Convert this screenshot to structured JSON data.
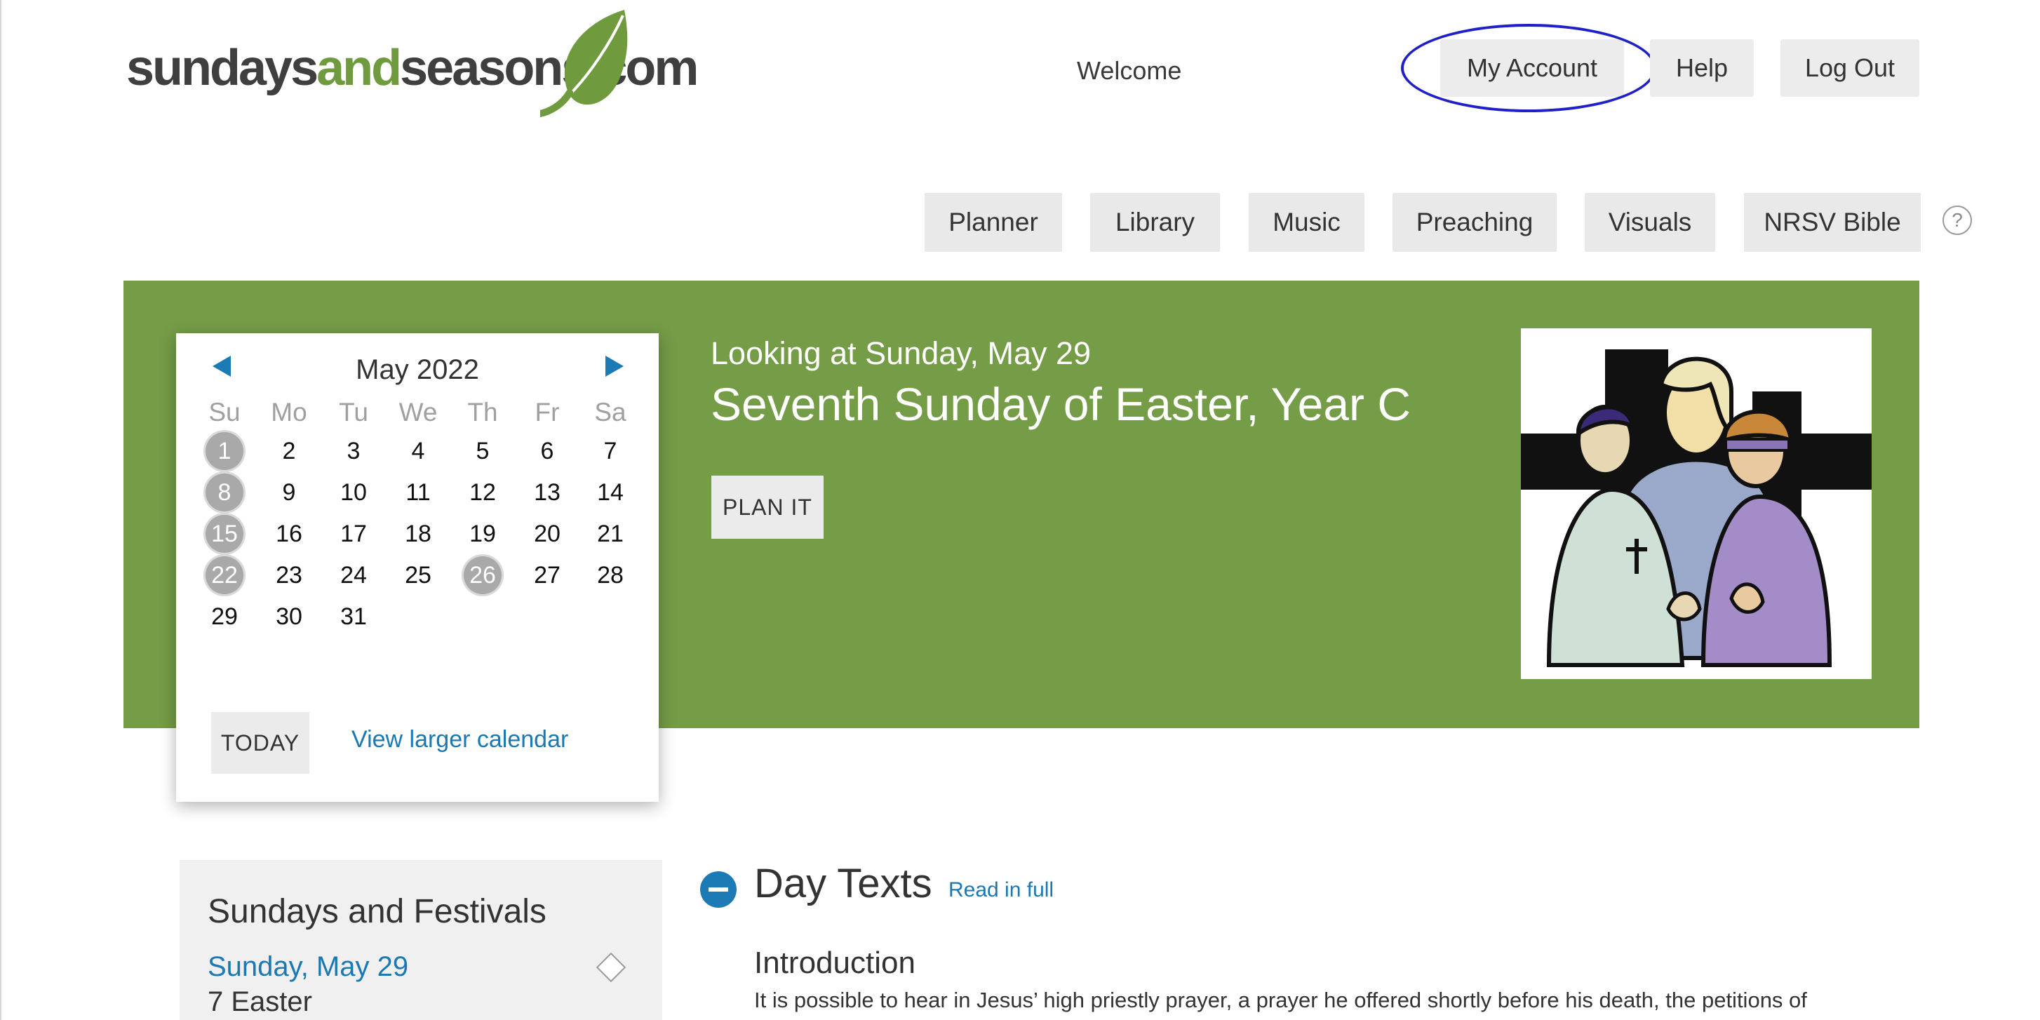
{
  "brand": {
    "logo_part1": "sundays",
    "logo_part2": "and",
    "logo_part3": "seasons.com",
    "dark_color": "#3f3f3f",
    "green_color": "#6f9a3e"
  },
  "header": {
    "welcome": "Welcome",
    "my_account": "My Account",
    "help": "Help",
    "log_out": "Log Out",
    "highlight_color": "#2020c8"
  },
  "nav": {
    "items": [
      "Planner",
      "Library",
      "Music",
      "Preaching",
      "Visuals",
      "NRSV Bible"
    ],
    "help_icon": "?"
  },
  "banner": {
    "background_color": "#759c47",
    "looking_at": "Looking at Sunday, May 29",
    "occasion": "Seventh Sunday of Easter, Year C",
    "plan_button": "PLAN IT",
    "artwork": "praying-figures-illustration"
  },
  "calendar": {
    "month_label": "May 2022",
    "prev_icon": "triangle-left-icon",
    "next_icon": "triangle-right-icon",
    "weekdays": [
      "Su",
      "Mo",
      "Tu",
      "We",
      "Th",
      "Fr",
      "Sa"
    ],
    "weeks": [
      [
        "1",
        "2",
        "3",
        "4",
        "5",
        "6",
        "7"
      ],
      [
        "8",
        "9",
        "10",
        "11",
        "12",
        "13",
        "14"
      ],
      [
        "15",
        "16",
        "17",
        "18",
        "19",
        "20",
        "21"
      ],
      [
        "22",
        "23",
        "24",
        "25",
        "26",
        "27",
        "28"
      ],
      [
        "29",
        "30",
        "31",
        "",
        "",
        "",
        ""
      ]
    ],
    "marked_days": [
      "1",
      "8",
      "15",
      "22",
      "26"
    ],
    "today_button": "TODAY",
    "larger_link": "View larger calendar",
    "accent_color": "#1c7bb5"
  },
  "sidebar": {
    "title": "Sundays and Festivals",
    "date_link": "Sunday, May 29",
    "subtitle": "7 Easter"
  },
  "main": {
    "section_title": "Day Texts",
    "read_full": "Read in full",
    "intro_heading": "Introduction",
    "intro_text": "It is possible to hear in Jesus’ high priestly prayer, a prayer he offered shortly before his death, the petitions of"
  }
}
